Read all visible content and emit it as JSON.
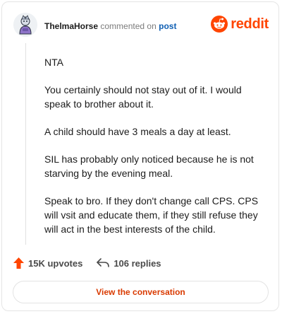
{
  "header": {
    "username": "ThelmaHorse",
    "action_text": "commented on",
    "post_link": "post",
    "brand": "reddit"
  },
  "comment": {
    "paragraphs": [
      "NTA",
      "You certainly should not stay out of it. I would speak to brother about it.",
      "A child should have 3 meals a day at least.",
      "SIL has probably only noticed because he is not starving by the evening meal.",
      "Speak to bro. If they don't change call CPS. CPS will vsit and educate them, if they still refuse they will act in the best interests of the child."
    ]
  },
  "actions": {
    "upvotes": "15K upvotes",
    "replies": "106 replies"
  },
  "cta": {
    "label": "View the conversation"
  },
  "colors": {
    "brand": "#ff4500",
    "link": "#0f5fb3",
    "cta_text": "#d93a00"
  },
  "icons": {
    "avatar": "avatar",
    "logo": "reddit-alien-icon",
    "upvote": "upvote-arrow-icon",
    "reply": "reply-arrow-icon"
  }
}
